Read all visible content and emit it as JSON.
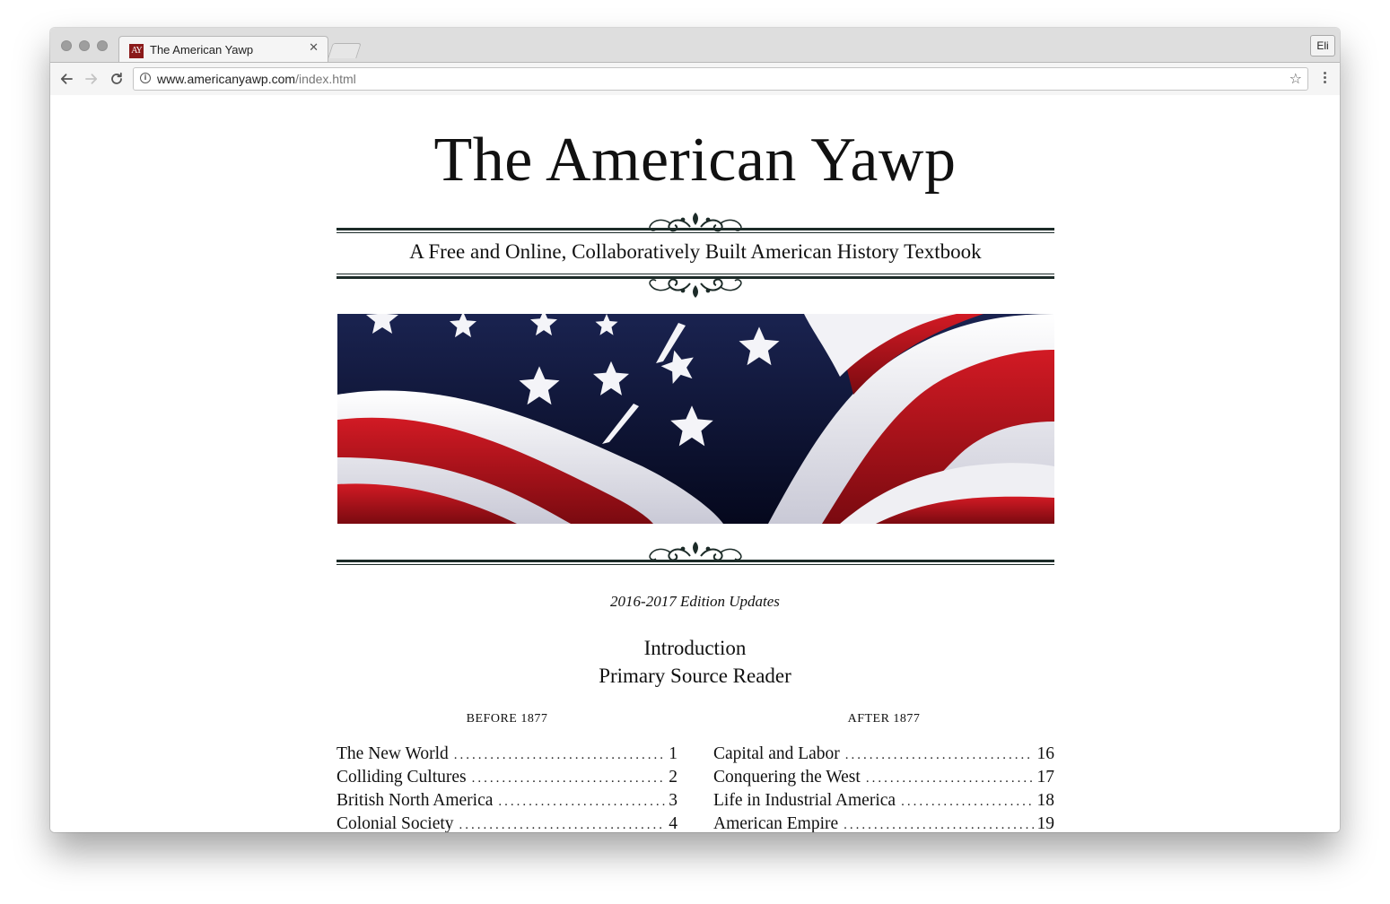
{
  "browser": {
    "tab_title": "The American Yawp",
    "favicon_text": "AY",
    "close_glyph": "✕",
    "profile_label": "Eli",
    "url_host": "www.americanyawp.com",
    "url_path": "/index.html"
  },
  "page": {
    "title": "The American Yawp",
    "subtitle": "A Free and Online, Collaboratively Built American History Textbook",
    "edition_link": "2016-2017 Edition Updates",
    "links": [
      "Introduction",
      "Primary Source Reader"
    ],
    "hero_image": "american-flag-photo",
    "before": {
      "heading": "BEFORE 1877",
      "chapters": [
        {
          "title": "The New World",
          "number": "1"
        },
        {
          "title": "Colliding Cultures",
          "number": "2"
        },
        {
          "title": "British North America",
          "number": "3"
        },
        {
          "title": "Colonial Society",
          "number": "4"
        }
      ]
    },
    "after": {
      "heading": "AFTER 1877",
      "chapters": [
        {
          "title": "Capital and Labor",
          "number": "16"
        },
        {
          "title": "Conquering the West",
          "number": "17"
        },
        {
          "title": "Life in Industrial America",
          "number": "18"
        },
        {
          "title": "American Empire",
          "number": "19"
        }
      ]
    }
  },
  "colors": {
    "rule": "#1c2b28",
    "flag_red": "#b3111c",
    "flag_blue": "#0c1236",
    "favicon_bg": "#8b1a1a"
  }
}
